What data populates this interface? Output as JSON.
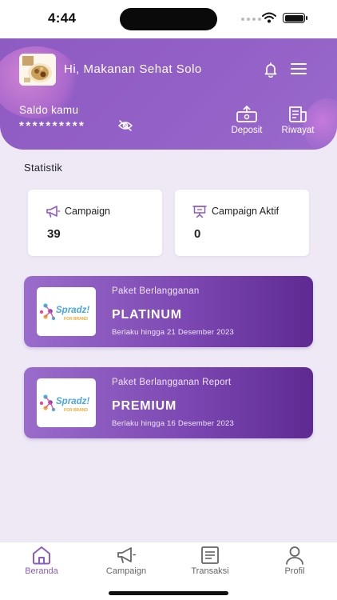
{
  "status_bar": {
    "time": "4:44"
  },
  "header": {
    "greeting": "Hi, Makanan Sehat Solo",
    "saldo_label": "Saldo kamu",
    "saldo_value": "**********",
    "actions": [
      {
        "label": "Deposit",
        "icon": "deposit-icon"
      },
      {
        "label": "Riwayat",
        "icon": "history-icon"
      }
    ]
  },
  "statistik": {
    "title": "Statistik",
    "cards": [
      {
        "label": "Campaign",
        "value": "39",
        "icon": "megaphone-icon"
      },
      {
        "label": "Campaign Aktif",
        "value": "0",
        "icon": "presentation-icon"
      }
    ]
  },
  "subscriptions": [
    {
      "kind": "Paket Berlangganan",
      "plan": "PLATINUM",
      "valid": "Berlaku hingga 21 Desember 2023"
    },
    {
      "kind": "Paket Berlangganan Report",
      "plan": "PREMIUM",
      "valid": "Berlaku hingga 16 Desember 2023"
    }
  ],
  "logo": {
    "word": "Spradz!",
    "tagline": "FOR BRAND"
  },
  "nav": [
    {
      "label": "Beranda",
      "icon": "home-icon",
      "active": true
    },
    {
      "label": "Campaign",
      "icon": "megaphone-icon",
      "active": false
    },
    {
      "label": "Transaksi",
      "icon": "receipt-icon",
      "active": false
    },
    {
      "label": "Profil",
      "icon": "user-icon",
      "active": false
    }
  ],
  "colors": {
    "primary": "#8e5bc3",
    "card_dark": "#5e2a92",
    "background": "#efe9f6"
  }
}
